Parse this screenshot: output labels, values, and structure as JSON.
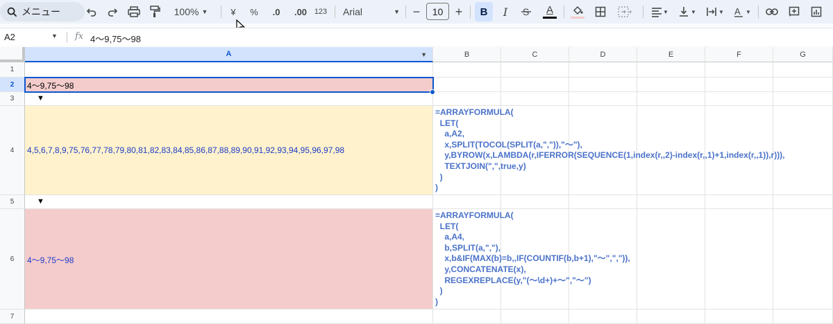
{
  "toolbar": {
    "search_label": "メニュー",
    "zoom": "100%",
    "currency": "¥",
    "percent": "%",
    "decimal_decrease": ".0",
    "decimal_increase": ".00",
    "number_format": "123",
    "font": "Arial",
    "font_size": "10",
    "bold": "B",
    "italic": "I",
    "text_color": "A"
  },
  "formula_bar": {
    "name_box": "A2",
    "fx": "fx",
    "value": "4〜9,75〜98"
  },
  "columns": [
    "A",
    "B",
    "C",
    "D",
    "E",
    "F",
    "G"
  ],
  "rows": [
    "1",
    "2",
    "3",
    "4",
    "5",
    "6",
    "7"
  ],
  "cells": {
    "A2": "4〜9,75〜98",
    "A3": "▼",
    "A4": "4,5,6,7,8,9,75,76,77,78,79,80,81,82,83,84,85,86,87,88,89,90,91,92,93,94,95,96,97,98",
    "A5": "▼",
    "A6": "4〜9,75〜98",
    "B4_lines": [
      "=ARRAYFORMULA(",
      "  LET(",
      "    a,A2,",
      "    x,SPLIT(TOCOL(SPLIT(a,\",\")),\"〜\"),",
      "    y,BYROW(x,LAMBDA(r,IFERROR(SEQUENCE(1,index(r,,2)-index(r,,1)+1,index(r,,1)),r))),",
      "    TEXTJOIN(\",\",true,y)",
      "  )",
      ")"
    ],
    "B6_lines": [
      "=ARRAYFORMULA(",
      "  LET(",
      "    a,A4,",
      "    b,SPLIT(a,\",\"),",
      "    x,b&IF(MAX(b)=b,,IF(COUNTIF(b,b+1),\"〜\",\",\")),",
      "    y,CONCATENATE(x),",
      "    REGEXREPLACE(y,\"(〜\\d+)+〜\",\"〜\")",
      "  )",
      ")"
    ]
  },
  "colors": {
    "pink": "#f4cccc",
    "yellow": "#fff2cc",
    "formula_blue": "#4a72c9",
    "value_blue": "#1f3cc7",
    "selection": "#0b57d0"
  }
}
